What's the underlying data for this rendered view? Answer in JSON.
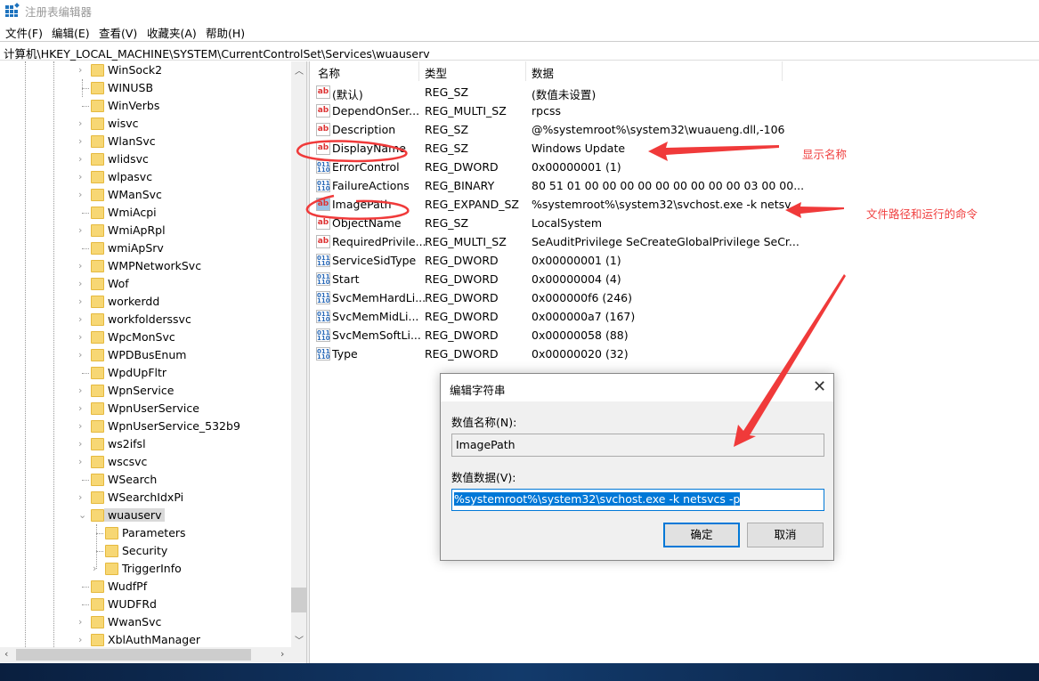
{
  "window": {
    "title": "注册表编辑器",
    "icon": "regedit-icon"
  },
  "menu": [
    "文件(F)",
    "编辑(E)",
    "查看(V)",
    "收藏夹(A)",
    "帮助(H)"
  ],
  "path": "计算机\\HKEY_LOCAL_MACHINE\\SYSTEM\\CurrentControlSet\\Services\\wuauserv",
  "tree": [
    {
      "label": "WinSock2",
      "expandable": true
    },
    {
      "label": "WINUSB",
      "expandable": false
    },
    {
      "label": "WinVerbs",
      "expandable": false
    },
    {
      "label": "wisvc",
      "expandable": true
    },
    {
      "label": "WlanSvc",
      "expandable": true
    },
    {
      "label": "wlidsvc",
      "expandable": true
    },
    {
      "label": "wlpasvc",
      "expandable": true
    },
    {
      "label": "WManSvc",
      "expandable": true
    },
    {
      "label": "WmiAcpi",
      "expandable": false
    },
    {
      "label": "WmiApRpl",
      "expandable": true
    },
    {
      "label": "wmiApSrv",
      "expandable": false
    },
    {
      "label": "WMPNetworkSvc",
      "expandable": true
    },
    {
      "label": "Wof",
      "expandable": true
    },
    {
      "label": "workerdd",
      "expandable": true
    },
    {
      "label": "workfolderssvc",
      "expandable": true
    },
    {
      "label": "WpcMonSvc",
      "expandable": true
    },
    {
      "label": "WPDBusEnum",
      "expandable": true
    },
    {
      "label": "WpdUpFltr",
      "expandable": false
    },
    {
      "label": "WpnService",
      "expandable": true
    },
    {
      "label": "WpnUserService",
      "expandable": true
    },
    {
      "label": "WpnUserService_532b9",
      "expandable": true
    },
    {
      "label": "ws2ifsl",
      "expandable": true
    },
    {
      "label": "wscsvc",
      "expandable": true
    },
    {
      "label": "WSearch",
      "expandable": false
    },
    {
      "label": "WSearchIdxPi",
      "expandable": true
    },
    {
      "label": "wuauserv",
      "expandable": true,
      "expanded": true,
      "selected": true
    },
    {
      "label": "Parameters",
      "expandable": false,
      "child": true
    },
    {
      "label": "Security",
      "expandable": false,
      "child": true
    },
    {
      "label": "TriggerInfo",
      "expandable": true,
      "child": true
    },
    {
      "label": "WudfPf",
      "expandable": false
    },
    {
      "label": "WUDFRd",
      "expandable": false
    },
    {
      "label": "WwanSvc",
      "expandable": true
    },
    {
      "label": "XblAuthManager",
      "expandable": true
    }
  ],
  "list": {
    "headers": [
      "名称",
      "类型",
      "数据"
    ],
    "rows": [
      {
        "name": "(默认)",
        "type": "REG_SZ",
        "data": "(数值未设置)",
        "icon": "string"
      },
      {
        "name": "DependOnSer...",
        "type": "REG_MULTI_SZ",
        "data": "rpcss",
        "icon": "string"
      },
      {
        "name": "Description",
        "type": "REG_SZ",
        "data": "@%systemroot%\\system32\\wuaueng.dll,-106",
        "icon": "string"
      },
      {
        "name": "DisplayName",
        "type": "REG_SZ",
        "data": "Windows Update",
        "icon": "string"
      },
      {
        "name": "ErrorControl",
        "type": "REG_DWORD",
        "data": "0x00000001 (1)",
        "icon": "binary"
      },
      {
        "name": "FailureActions",
        "type": "REG_BINARY",
        "data": "80 51 01 00 00 00 00 00 00 00 00 00 03 00 00...",
        "icon": "binary"
      },
      {
        "name": "ImagePath",
        "type": "REG_EXPAND_SZ",
        "data": "%systemroot%\\system32\\svchost.exe -k netsv...",
        "icon": "string",
        "selected": true
      },
      {
        "name": "ObjectName",
        "type": "REG_SZ",
        "data": "LocalSystem",
        "icon": "string"
      },
      {
        "name": "RequiredPrivile...",
        "type": "REG_MULTI_SZ",
        "data": "SeAuditPrivilege SeCreateGlobalPrivilege SeCr...",
        "icon": "string"
      },
      {
        "name": "ServiceSidType",
        "type": "REG_DWORD",
        "data": "0x00000001 (1)",
        "icon": "binary"
      },
      {
        "name": "Start",
        "type": "REG_DWORD",
        "data": "0x00000004 (4)",
        "icon": "binary"
      },
      {
        "name": "SvcMemHardLi...",
        "type": "REG_DWORD",
        "data": "0x000000f6 (246)",
        "icon": "binary"
      },
      {
        "name": "SvcMemMidLi...",
        "type": "REG_DWORD",
        "data": "0x000000a7 (167)",
        "icon": "binary"
      },
      {
        "name": "SvcMemSoftLi...",
        "type": "REG_DWORD",
        "data": "0x00000058 (88)",
        "icon": "binary"
      },
      {
        "name": "Type",
        "type": "REG_DWORD",
        "data": "0x00000020 (32)",
        "icon": "binary"
      }
    ]
  },
  "dialog": {
    "title": "编辑字符串",
    "name_label": "数值名称(N):",
    "name_value": "ImagePath",
    "data_label": "数值数据(V):",
    "data_value": "%systemroot%\\system32\\svchost.exe -k netsvcs -p",
    "ok": "确定",
    "cancel": "取消",
    "close": "✕"
  },
  "annotations": {
    "display_name_note": "显示名称",
    "image_path_note": "文件路径和运行的命令",
    "color": "#f04040"
  }
}
